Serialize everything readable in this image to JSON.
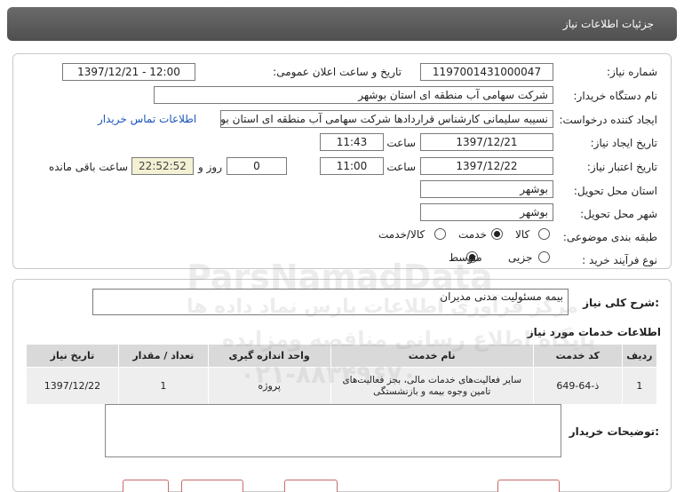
{
  "header": {
    "title": "جزئیات اطلاعات نیاز"
  },
  "info": {
    "need_number_label": "شماره نیاز:",
    "need_number": "1197001431000047",
    "announce_label": "تاریخ و ساعت اعلان عمومی:",
    "announce_value": "1397/12/21 - 12:00",
    "buyer_org_label": "نام دستگاه خریدار:",
    "buyer_org": "شرکت سهامی آب منطقه ای استان بوشهر",
    "requester_label": "ایجاد کننده درخواست:",
    "requester": "نسیبه سلیمانی کارشناس قراردادها شرکت سهامی آب منطقه ای استان بوشهر",
    "contact_link": "اطلاعات تماس خریدار",
    "created_label": "تاریخ ایجاد نیاز:",
    "created_date": "1397/12/21",
    "created_time_label": "ساعت",
    "created_time": "11:43",
    "valid_label": "تاریخ اعتبار نیاز:",
    "valid_date": "1397/12/22",
    "valid_time_label": "ساعت",
    "valid_time": "11:00",
    "days": "0",
    "days_label": "روز و",
    "remaining": "22:52:52",
    "remaining_label": "ساعت باقی مانده",
    "province_label": "استان محل تحویل:",
    "province": "بوشهر",
    "city_label": "شهر محل تحویل:",
    "city": "بوشهر",
    "category_label": "طبقه بندی موضوعی:",
    "category_options": [
      "کالا",
      "خدمت",
      "کالا/خدمت"
    ],
    "process_label": "نوع فرآیند خرید :",
    "process_options": [
      "جزیی",
      "متوسط"
    ]
  },
  "summary": {
    "label": "شرح کلی نیاز:",
    "value": "بیمه مسئولیت مدنی مدیران"
  },
  "services": {
    "title": "اطلاعات خدمات مورد نیاز",
    "headers": [
      "ردیف",
      "کد خدمت",
      "نام خدمت",
      "واحد اندازه گیری",
      "تعداد / مقدار",
      "تاریخ نیاز"
    ],
    "rows": [
      [
        "1",
        "ذ-64-649",
        "سایر فعالیت‌های خدمات مالی، بجز فعالیت‌های تامین وجوه بیمه و بازنشستگی",
        "پروژه",
        "1",
        "1397/12/22"
      ]
    ]
  },
  "buyer_notes": {
    "label": "توضیحات خریدار:"
  },
  "watermark": {
    "line1": "ParsNamadData",
    "line2": "مرکز فرآوری اطلاعات پارس نماد داده ها",
    "line3": "پایگاه اطلاع رسانی مناقصه ومزایده",
    "line4": "۰۲۱-۸۸۳۴۹۶۷۰"
  }
}
